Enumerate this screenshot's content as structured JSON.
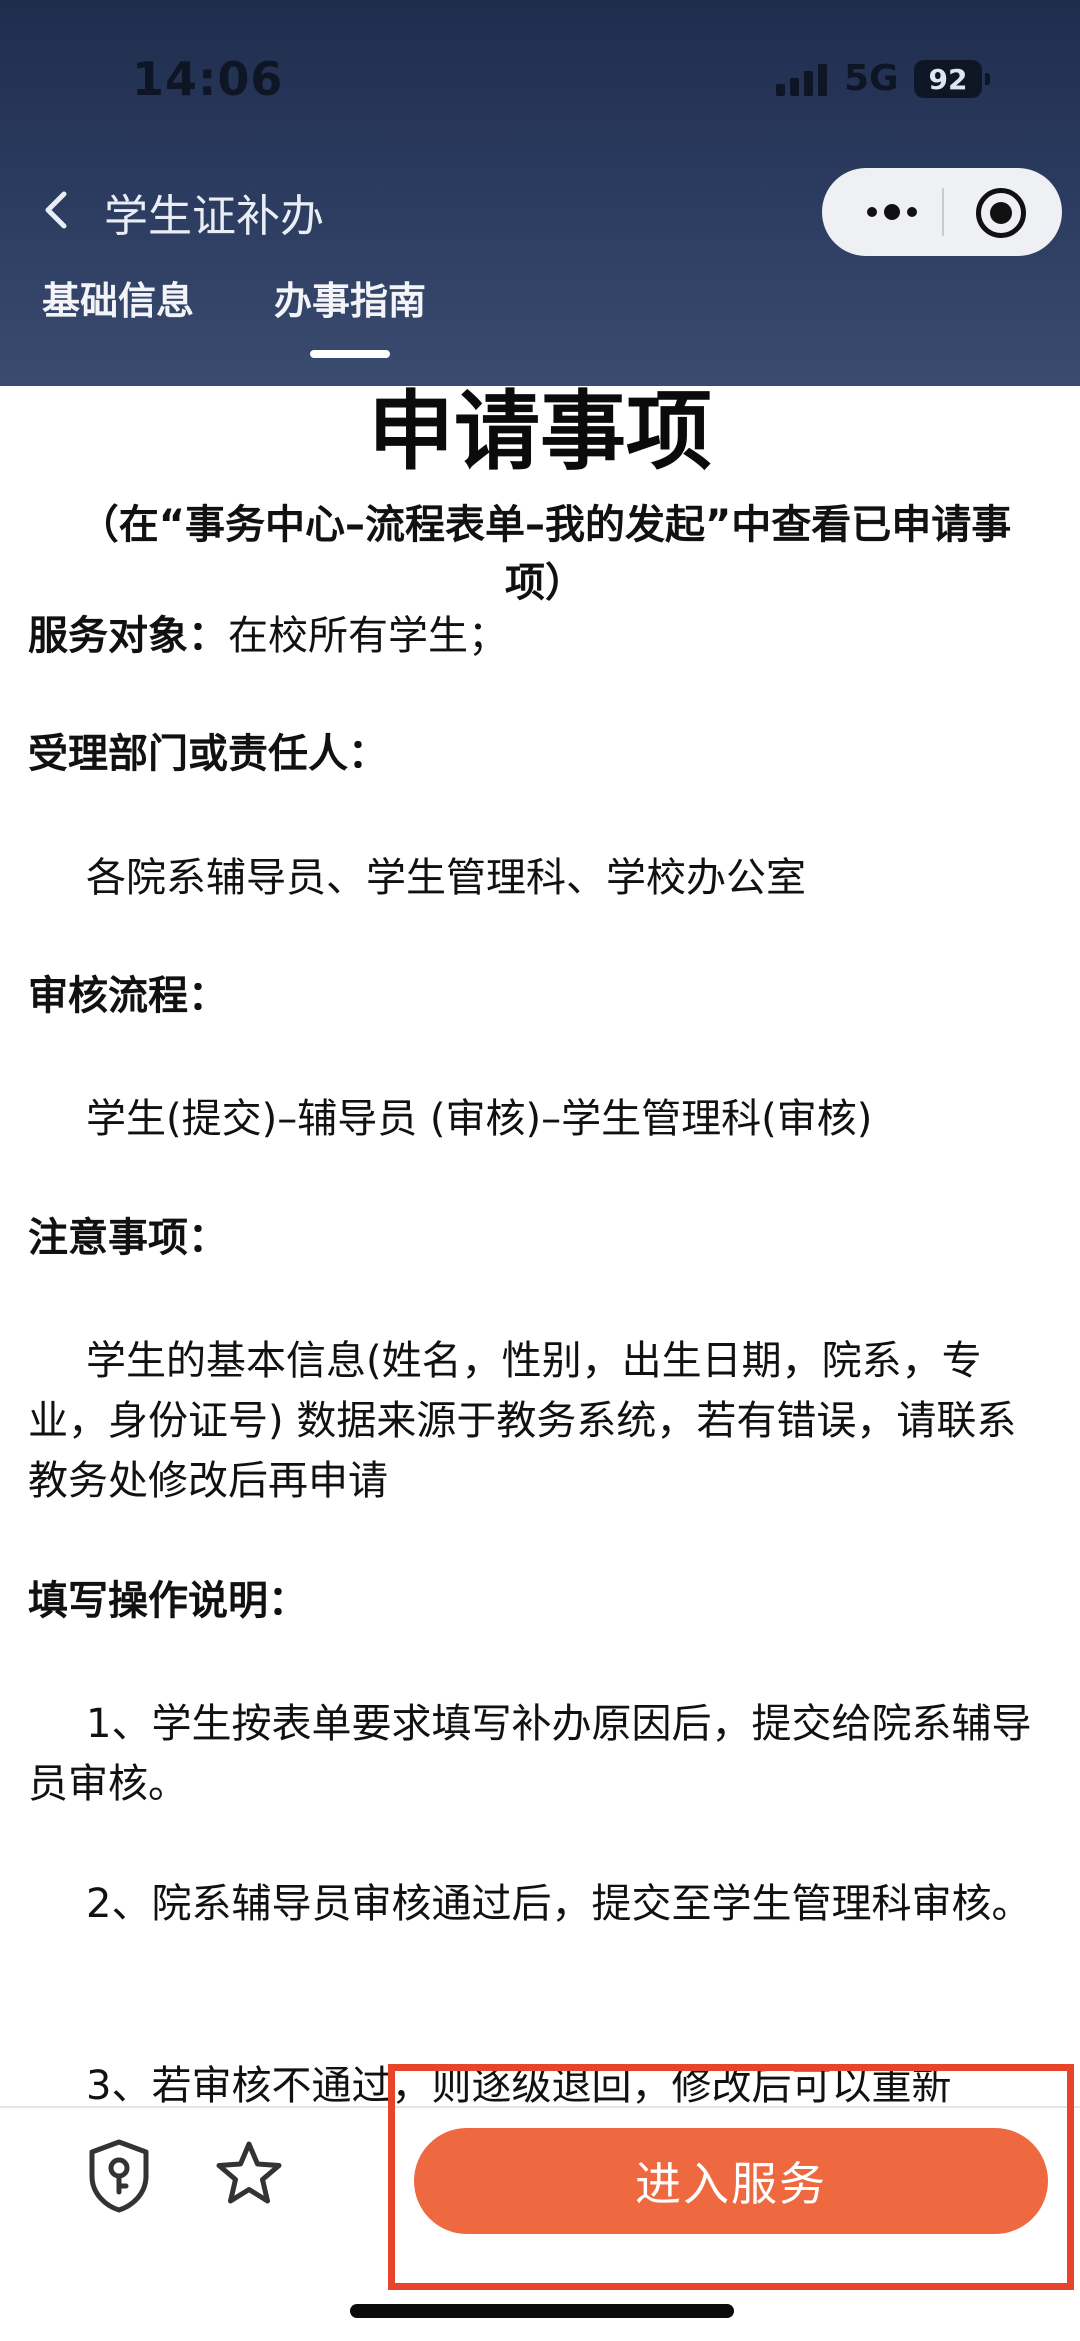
{
  "status_bar": {
    "time": "14:06",
    "network": "5G",
    "battery": "92"
  },
  "nav": {
    "title": "学生证补办",
    "back_icon": "chevron-left-icon",
    "more_icon": "more-dots-icon",
    "close_icon": "target-circle-icon"
  },
  "tabs": [
    {
      "label": "基础信息",
      "active": false
    },
    {
      "label": "办事指南",
      "active": true
    }
  ],
  "content": {
    "heading": "申请事项",
    "subheading": "（在“事务中心–流程表单–我的发起”中查看已申请事项）",
    "service_target_label": "服务对象：",
    "service_target_value": "在校所有学生；",
    "dept_label": "受理部门或责任人：",
    "dept_value": "各院系辅导员、学生管理科、学校办公室",
    "flow_label": "审核流程：",
    "flow_value": "学生(提交)–辅导员 (审核)–学生管理科(审核)",
    "notes_label": "注意事项：",
    "notes_value": "学生的基本信息(姓名，性别，出生日期，院系，专业，身份证号) 数据来源于教务系统，若有错误，请联系教务处修改后再申请",
    "instructions_label": "填写操作说明：",
    "step1": "1、学生按表单要求填写补办原因后，提交给院系辅导员审核。",
    "step2": "2、院系辅导员审核通过后，提交至学生管理科审核。",
    "step3": "3、若审核不通过，则逐级退回，修改后可以重新"
  },
  "bottom": {
    "button_label": "进入服务",
    "button_color": "#ee6840",
    "highlight_color": "#e8442a",
    "icons": [
      "shield-key-icon",
      "star-icon"
    ]
  }
}
